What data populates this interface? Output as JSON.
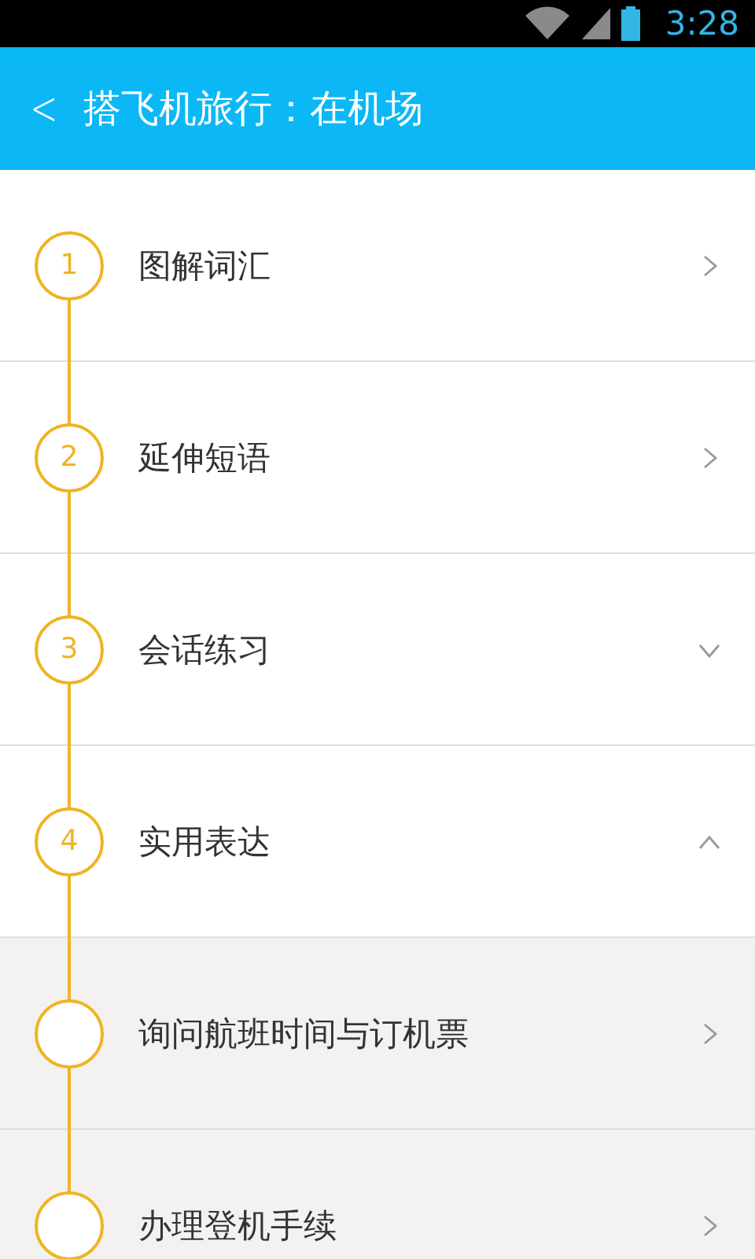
{
  "status_bar": {
    "time": "3:28"
  },
  "header": {
    "back": "<",
    "title": "搭飞机旅行：在机场"
  },
  "steps": [
    {
      "number": "1",
      "title": "图解词汇",
      "kind": "link"
    },
    {
      "number": "2",
      "title": "延伸短语",
      "kind": "link"
    },
    {
      "number": "3",
      "title": "会话练习",
      "kind": "section",
      "expanded": false
    },
    {
      "number": "4",
      "title": "实用表达",
      "kind": "section",
      "expanded": true,
      "children": [
        {
          "title": "询问航班时间与订机票",
          "kind": "link"
        },
        {
          "title": "办理登机手续",
          "kind": "link"
        }
      ]
    }
  ]
}
